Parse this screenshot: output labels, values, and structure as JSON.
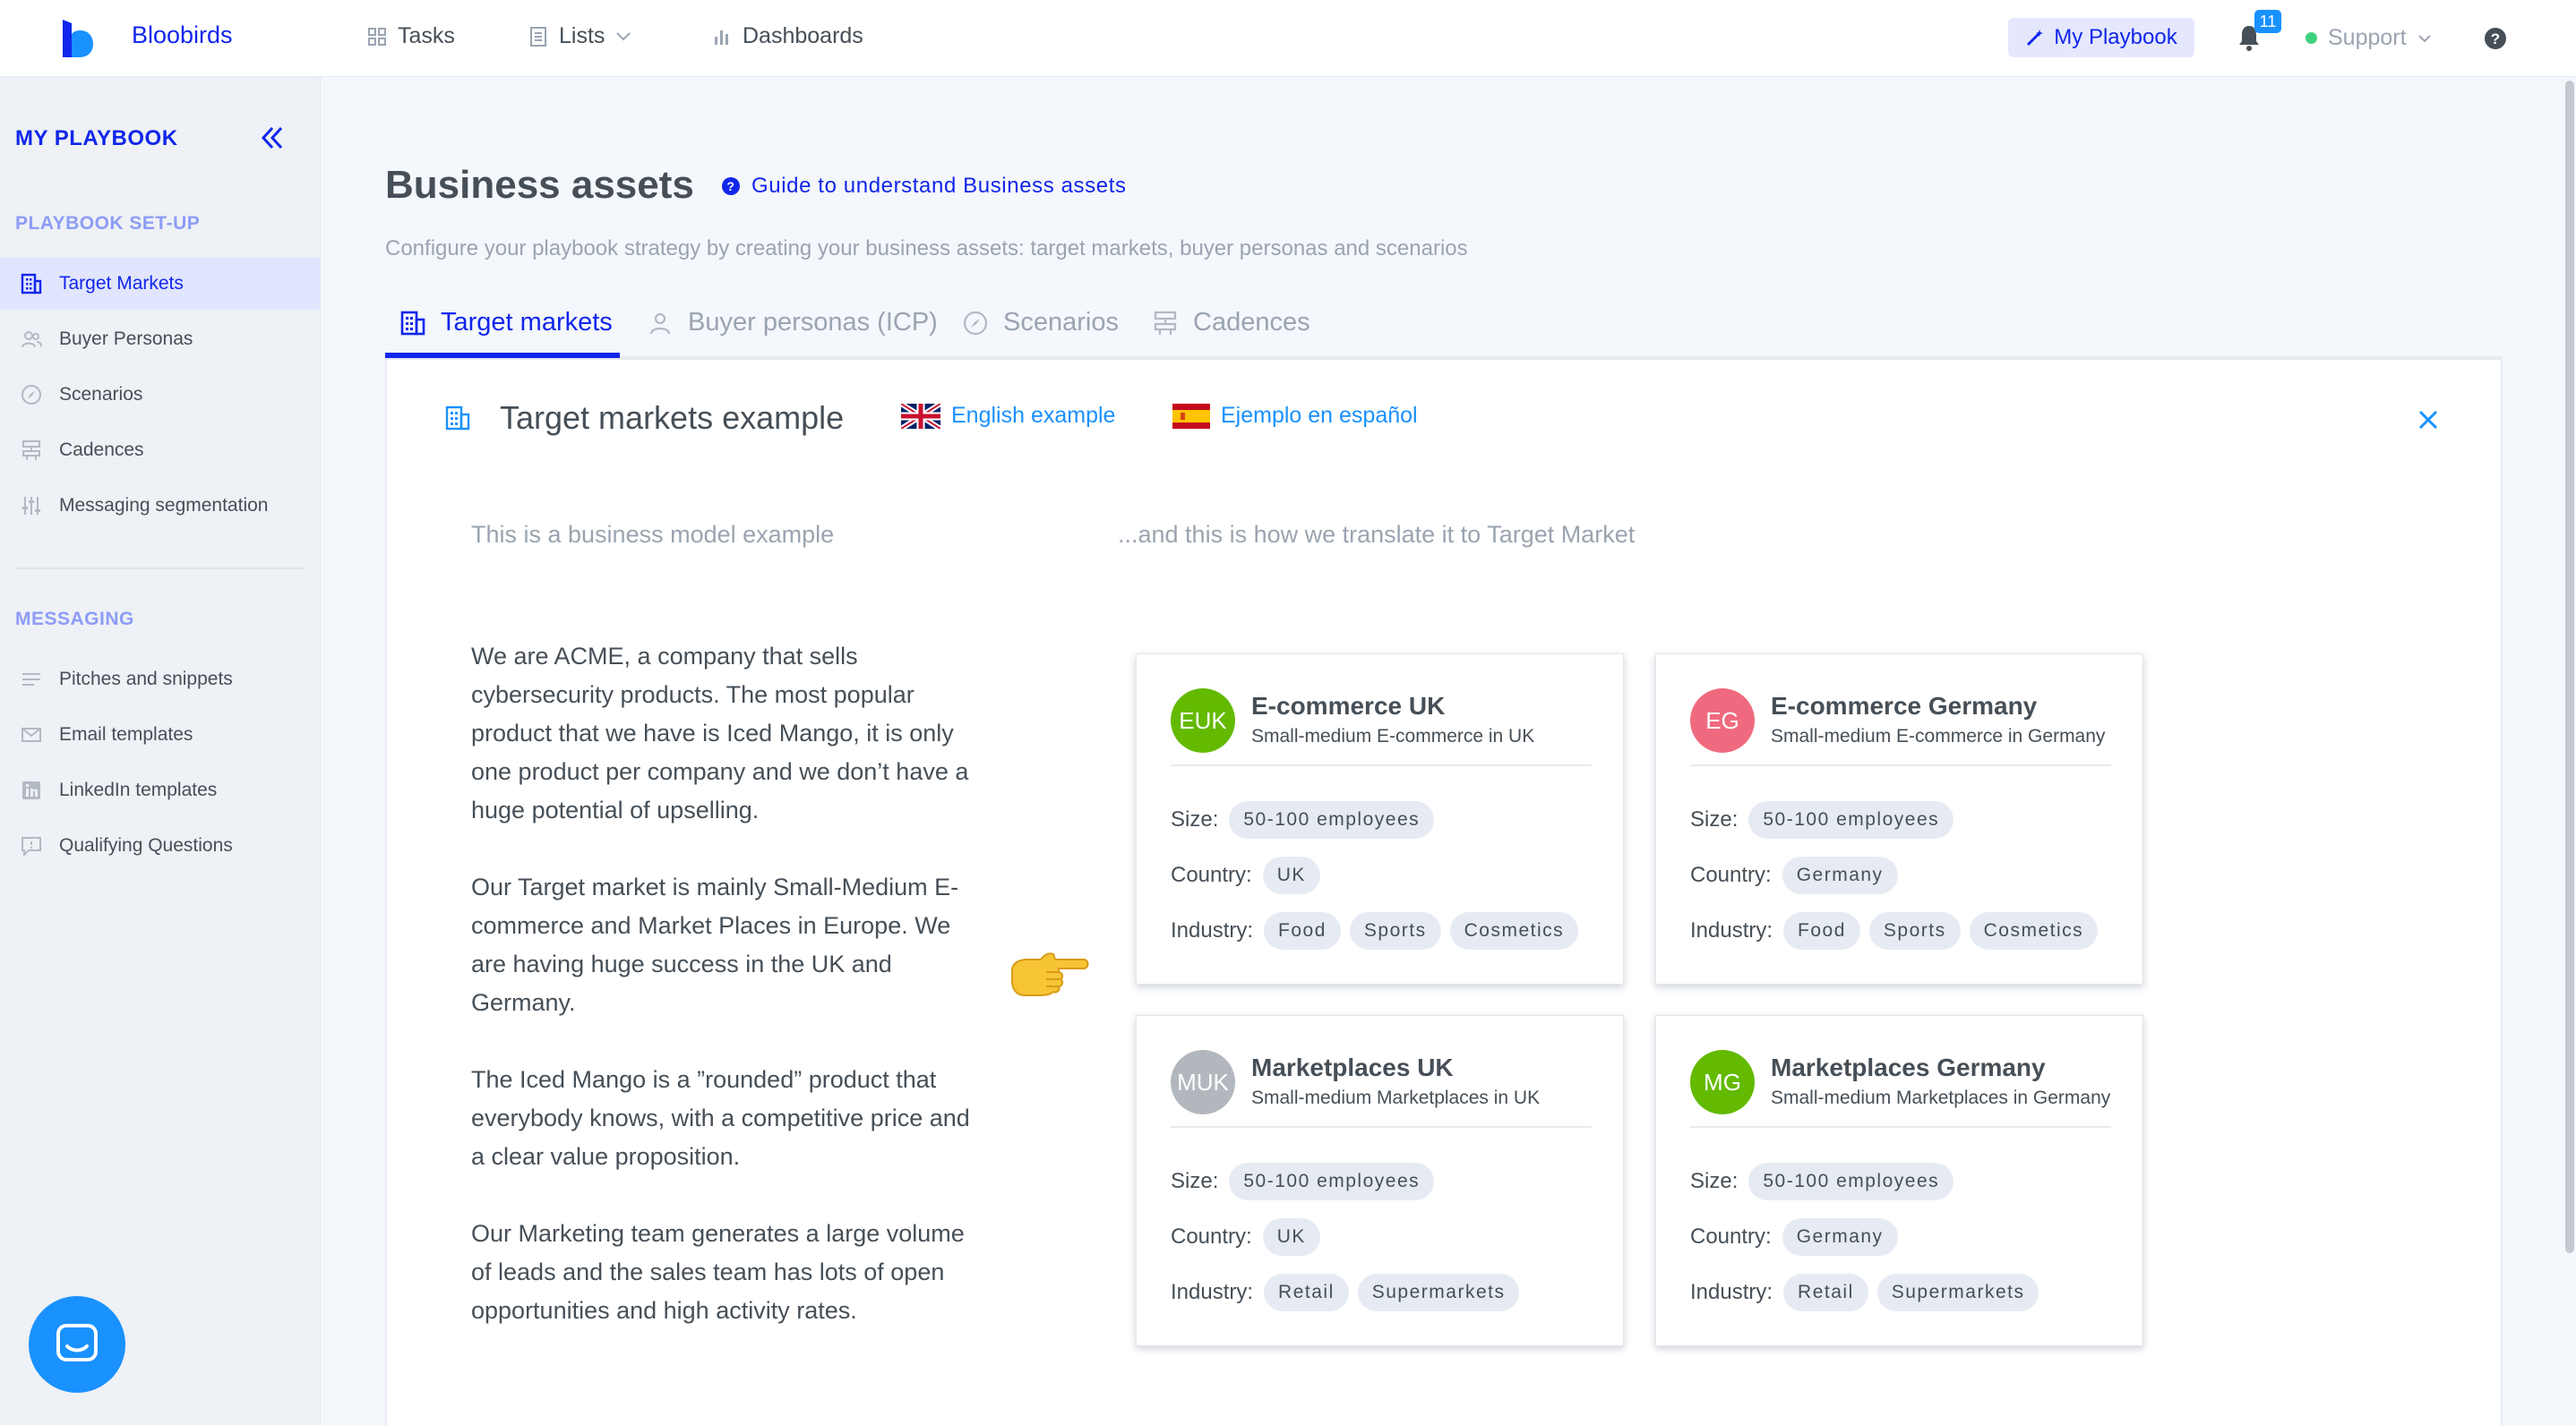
{
  "app": {
    "name": "Bloobirds"
  },
  "nav": {
    "tasks": "Tasks",
    "lists": "Lists",
    "dashboards": "Dashboards",
    "my_playbook": "My Playbook",
    "notification_count": "11",
    "support": "Support"
  },
  "sidebar": {
    "title": "MY PLAYBOOK",
    "setup_section": "PLAYBOOK SET-UP",
    "setup_items": [
      {
        "label": "Target Markets",
        "icon": "building-icon",
        "active": true
      },
      {
        "label": "Buyer Personas",
        "icon": "people-icon"
      },
      {
        "label": "Scenarios",
        "icon": "compass-icon"
      },
      {
        "label": "Cadences",
        "icon": "cadence-icon"
      },
      {
        "label": "Messaging segmentation",
        "icon": "sliders-icon"
      }
    ],
    "messaging_section": "MESSAGING",
    "messaging_items": [
      {
        "label": "Pitches and snippets",
        "icon": "lines-icon"
      },
      {
        "label": "Email templates",
        "icon": "mail-icon"
      },
      {
        "label": "LinkedIn templates",
        "icon": "linkedin-icon"
      },
      {
        "label": "Qualifying Questions",
        "icon": "question-chat-icon"
      }
    ]
  },
  "page": {
    "title": "Business assets",
    "guide_link": "Guide to understand Business assets",
    "subtitle": "Configure your playbook strategy by creating your business assets: target markets, buyer personas and scenarios"
  },
  "tabs": [
    {
      "label": "Target markets",
      "active": true
    },
    {
      "label": "Buyer personas (ICP)"
    },
    {
      "label": "Scenarios"
    },
    {
      "label": "Cadences"
    }
  ],
  "example": {
    "title": "Target markets example",
    "english_link": "English example",
    "spanish_link": "Ejemplo en español",
    "left_heading": "This is a business model example",
    "right_heading": "...and this is how we translate it to Target Market",
    "paragraphs": [
      "We are ACME, a company that sells cybersecurity products. The most popular product that we have is Iced Mango, it is only one product per company and we don’t have a huge potential of upselling.",
      "Our Target market is mainly Small-Medium E-commerce and Market Places in Europe. We are having huge success in the UK and Germany.",
      "The Iced Mango is a ”rounded” product that everybody knows, with a competitive price and a clear value proposition.",
      "Our Marketing team generates a large volume of leads and the sales team has lots of open opportunities and high activity rates."
    ]
  },
  "card_labels": {
    "size": "Size:",
    "country": "Country:",
    "industry": "Industry:"
  },
  "cards": [
    {
      "initials": "EUK",
      "color": "#63ba00",
      "name": "E-commerce UK",
      "description": "Small-medium E-commerce in UK",
      "size": "50-100 employees",
      "country": "UK",
      "industries": [
        "Food",
        "Sports",
        "Cosmetics"
      ]
    },
    {
      "initials": "EG",
      "color": "#f06a7f",
      "name": "E-commerce Germany",
      "description": "Small-medium E-commerce in Germany",
      "size": "50-100 employees",
      "country": "Germany",
      "industries": [
        "Food",
        "Sports",
        "Cosmetics"
      ]
    },
    {
      "initials": "MUK",
      "color": "#b2b7bd",
      "name": "Marketplaces UK",
      "description": "Small-medium Marketplaces in UK",
      "size": "50-100 employees",
      "country": "UK",
      "industries": [
        "Retail",
        "Supermarkets"
      ]
    },
    {
      "initials": "MG",
      "color": "#63ba00",
      "name": "Marketplaces Germany",
      "description": "Small-medium Marketplaces in Germany",
      "size": "50-100 employees",
      "country": "Germany",
      "industries": [
        "Retail",
        "Supermarkets"
      ]
    }
  ],
  "colors": {
    "brand": "#1126ea",
    "link": "#1991ff",
    "muted": "#9aa4b1",
    "text": "#464f57",
    "online": "#3fd17e"
  }
}
